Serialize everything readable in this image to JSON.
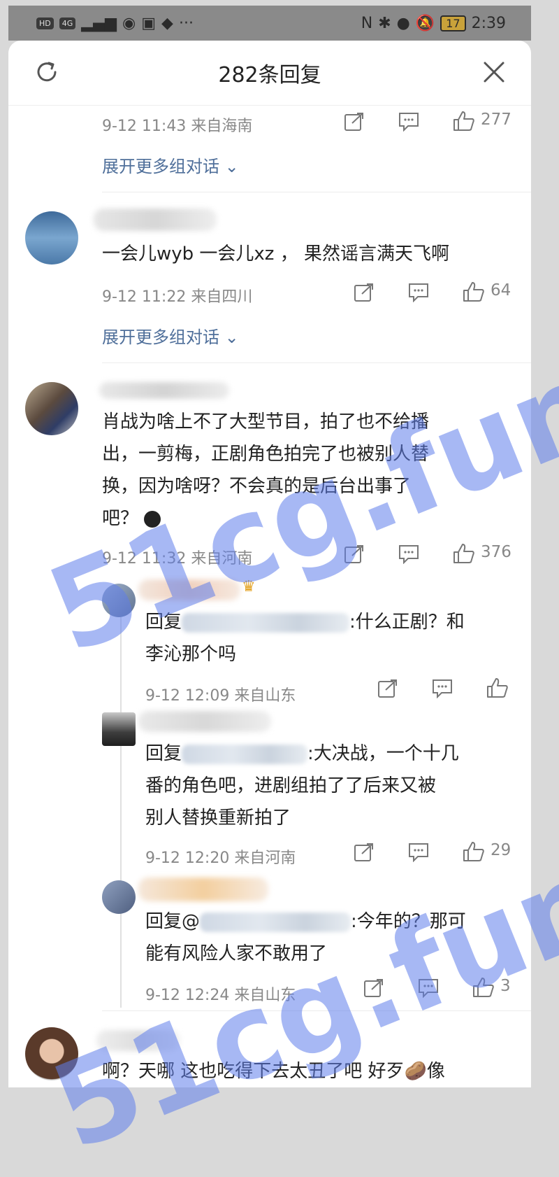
{
  "status_bar": {
    "left_icons": [
      "HD",
      "4G",
      "signal-bars-icon",
      "weibo-icon",
      "dashen-icon",
      "shield-icon"
    ],
    "more": "···",
    "battery": "17",
    "time": "2:39"
  },
  "header": {
    "title": "282条回复"
  },
  "comments": [
    {
      "meta": "9-12 11:43  来自海南",
      "likes": "277",
      "expand": "展开更多组对话"
    },
    {
      "text": "一会儿wyb 一会儿xz ， 果然谣言满天飞啊",
      "meta": "9-12 11:22  来自四川",
      "likes": "64",
      "expand": "展开更多组对话"
    },
    {
      "lines": [
        "肖战为啥上不了大型节目，拍了也不给播",
        "出，一剪梅，正剧角色拍完了也被别人替",
        "换，因为啥呀？不会真的是后台出事了",
        "吧？"
      ],
      "meta": "9-12 11:32  来自河南",
      "likes": "376"
    }
  ],
  "replies": [
    {
      "prefix": "回复",
      "line1_tail": ":什么正剧？和",
      "line2": "李沁那个吗",
      "meta": "9-12 12:09  来自山东",
      "likes": ""
    },
    {
      "prefix": "回复",
      "line1_tail": ":大决战，一个十几",
      "line2": "番的角色吧，进剧组拍了了后来又被",
      "line3": "别人替换重新拍了",
      "meta": "9-12 12:20  来自河南",
      "likes": "29"
    },
    {
      "prefix": "回复@",
      "line1_tail": ":今年的？那可",
      "line2": "能有风险人家不敢用了",
      "meta": "9-12 12:24  来自山东",
      "likes": "3"
    }
  ],
  "last_comment": {
    "text": "啊？天哪 这也吃得下去太丑了吧 好歹🥔像"
  },
  "watermark": "51cg.fun",
  "colors": {
    "link": "#4f6f9a",
    "meta": "#888888",
    "watermark": "#5f7deb"
  }
}
